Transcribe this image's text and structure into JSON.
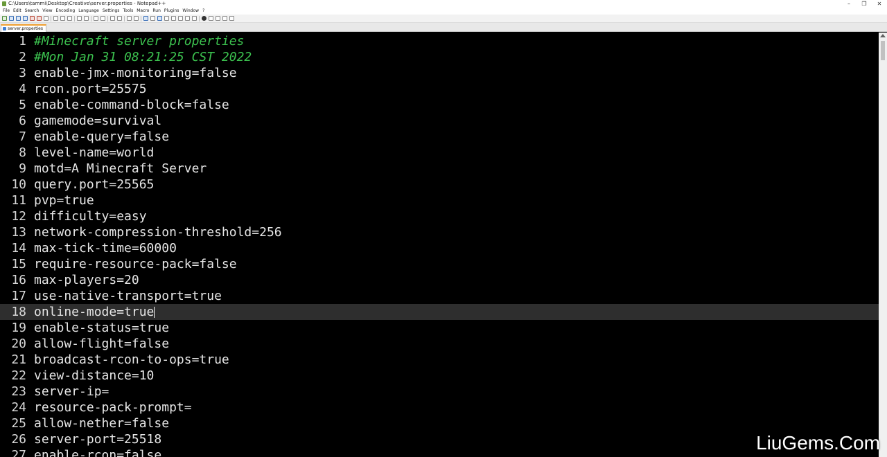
{
  "window": {
    "title": "C:\\Users\\tammi\\Desktop\\Creative\\server.properties - Notepad++",
    "controls": [
      "–",
      "❐",
      "✕"
    ]
  },
  "menu": [
    "File",
    "Edit",
    "Search",
    "View",
    "Encoding",
    "Language",
    "Settings",
    "Tools",
    "Macro",
    "Run",
    "Plugins",
    "Window",
    "?"
  ],
  "tab": {
    "label": "server.properties"
  },
  "editor": {
    "current_line": 18,
    "lines": [
      {
        "n": "1",
        "text": "#Minecraft server properties",
        "comment": true
      },
      {
        "n": "2",
        "text": "#Mon Jan 31 08:21:25 CST 2022",
        "comment": true
      },
      {
        "n": "3",
        "text": "enable-jmx-monitoring=false"
      },
      {
        "n": "4",
        "text": "rcon.port=25575"
      },
      {
        "n": "5",
        "text": "enable-command-block=false"
      },
      {
        "n": "6",
        "text": "gamemode=survival"
      },
      {
        "n": "7",
        "text": "enable-query=false"
      },
      {
        "n": "8",
        "text": "level-name=world"
      },
      {
        "n": "9",
        "text": "motd=A Minecraft Server"
      },
      {
        "n": "10",
        "text": "query.port=25565"
      },
      {
        "n": "11",
        "text": "pvp=true"
      },
      {
        "n": "12",
        "text": "difficulty=easy"
      },
      {
        "n": "13",
        "text": "network-compression-threshold=256"
      },
      {
        "n": "14",
        "text": "max-tick-time=60000"
      },
      {
        "n": "15",
        "text": "require-resource-pack=false"
      },
      {
        "n": "16",
        "text": "max-players=20"
      },
      {
        "n": "17",
        "text": "use-native-transport=true"
      },
      {
        "n": "18",
        "text": "online-mode=true"
      },
      {
        "n": "19",
        "text": "enable-status=true"
      },
      {
        "n": "20",
        "text": "allow-flight=false"
      },
      {
        "n": "21",
        "text": "broadcast-rcon-to-ops=true"
      },
      {
        "n": "22",
        "text": "view-distance=10"
      },
      {
        "n": "23",
        "text": "server-ip="
      },
      {
        "n": "24",
        "text": "resource-pack-prompt="
      },
      {
        "n": "25",
        "text": "allow-nether=false"
      },
      {
        "n": "26",
        "text": "server-port=25518"
      },
      {
        "n": "27",
        "text": "enable-rcon=false"
      }
    ]
  },
  "watermark": "LiuGems.Com",
  "colors": {
    "comment": "#3cc24f",
    "text": "#e6e6e6",
    "background": "#000000",
    "current_line": "#2e2e2e",
    "tab_accent": "#f0a030"
  }
}
